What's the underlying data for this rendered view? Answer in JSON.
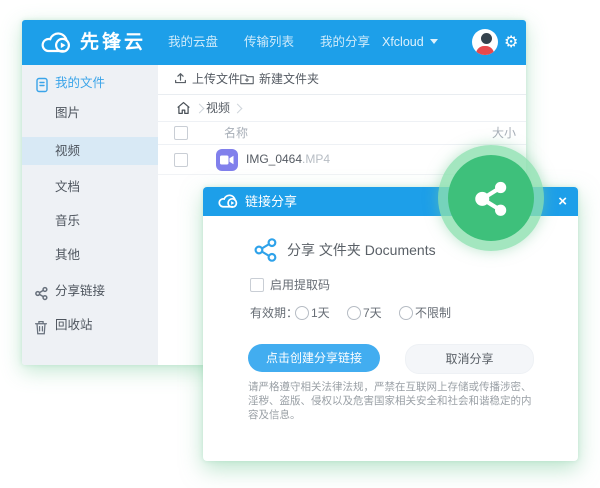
{
  "colors": {
    "header_blue": "#1d9fe9",
    "accent_green": "#3ec07b",
    "badge_ring_green": "#8ce0af",
    "file_icon_purple": "#8180ec",
    "selected_item_bg": "#d8e9f5",
    "primary_button_blue": "#42adf0"
  },
  "icons": {
    "settings": "⚙",
    "close": "×"
  },
  "main_window": {
    "header": {
      "logo_text": "先锋云",
      "nav": [
        "我的云盘",
        "传输列表",
        "我的分享"
      ],
      "account": "Xfcloud"
    },
    "sidebar": {
      "items": [
        {
          "label": "我的文件"
        },
        {
          "label": "图片"
        },
        {
          "label": "视频"
        },
        {
          "label": "文档"
        },
        {
          "label": "音乐"
        },
        {
          "label": "其他"
        },
        {
          "label": "分享链接"
        },
        {
          "label": "回收站"
        }
      ]
    },
    "toolbar": {
      "upload": "上传文件",
      "new_folder": "新建文件夹"
    },
    "breadcrumb": {
      "current": "视频"
    },
    "file_table": {
      "columns": {
        "name": "名称",
        "size": "大小"
      },
      "rows": [
        {
          "name": "IMG_0464",
          "ext": ".MP4"
        }
      ]
    }
  },
  "share_dialog": {
    "title": "链接分享",
    "share_line": "分享 文件夹 Documents",
    "enable_code_label": "启用提取码",
    "validity_label": "有效期：",
    "validity_options": [
      "1天",
      "7天",
      "不限制"
    ],
    "create_button": "点击创建分享链接",
    "cancel_button": "取消分享",
    "disclaimer": "请严格遵守相关法律法规，严禁在互联网上存储或传播涉密、淫秽、盗版、侵权以及危害国家相关安全和社会和谐稳定的内容及信息。"
  }
}
